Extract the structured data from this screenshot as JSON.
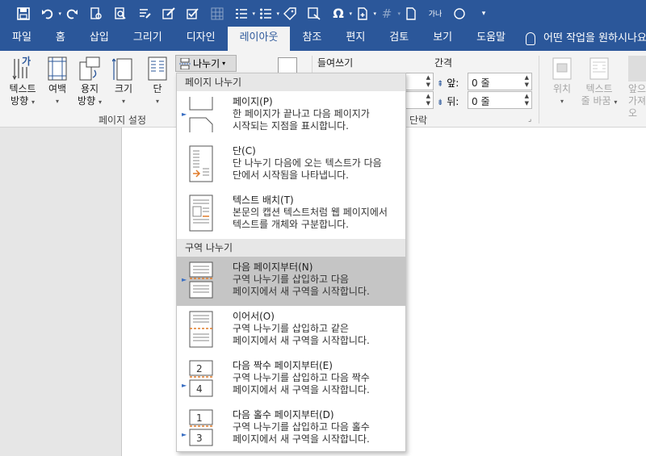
{
  "qat": {
    "buttons": [
      "save-icon",
      "undo-icon",
      "redo-icon",
      "print-preview-icon",
      "zoom-doc-icon",
      "format-painter-icon",
      "edit-icon",
      "edit-check-icon",
      "table-icon",
      "numbering-icon",
      "bullets-icon",
      "tag-icon",
      "insert-pic-icon",
      "omega-icon",
      "new-doc-icon",
      "hash-icon",
      "page-icon",
      "text-icon",
      "circle-icon",
      "more-icon"
    ],
    "text_small": "가나"
  },
  "tabs": [
    "파일",
    "홈",
    "삽입",
    "그리기",
    "디자인",
    "레이아웃",
    "참조",
    "편지",
    "검토",
    "보기",
    "도움말"
  ],
  "active_tab": "레이아웃",
  "tell_me": "어떤 작업을 원하시나요?",
  "ribbon": {
    "text_direction": [
      "텍스트",
      "방향"
    ],
    "margins": "여백",
    "orientation": [
      "용지",
      "방향"
    ],
    "size": "크기",
    "columns": "단",
    "group_page_setup": "페이지 설정",
    "breaks": "나누기",
    "indent_label": "들여쓰기",
    "spacing_label": "간격",
    "spacing_before_label": "앞:",
    "spacing_before": "0 줄",
    "spacing_after_label": "뒤:",
    "spacing_after": "0 줄",
    "group_paragraph": "단락",
    "position": "위치",
    "wrap_text": [
      "텍스트",
      "줄 바꿈"
    ],
    "bring_forward": [
      "앞으",
      "가져오"
    ]
  },
  "breaks_menu": {
    "section_page_breaks": "페이지 나누기",
    "section_section_breaks": "구역 나누기",
    "items": [
      {
        "title": "페이지(P)",
        "desc": [
          "한 페이지가 끝나고 다음 페이지가",
          "시작되는 지점을 표시합니다."
        ]
      },
      {
        "title": "단(C)",
        "desc": [
          "단 나누기 다음에 오는 텍스트가 다음",
          "단에서 시작됨을 나타냅니다."
        ]
      },
      {
        "title": "텍스트 배치(T)",
        "desc": [
          "본문의 캡션 텍스트처럼 웹 페이지에서",
          "텍스트를 개체와 구분합니다."
        ]
      },
      {
        "title": "다음 페이지부터(N)",
        "desc": [
          "구역 나누기를 삽입하고 다음",
          "페이지에서 새 구역을 시작합니다."
        ]
      },
      {
        "title": "이어서(O)",
        "desc": [
          "구역 나누기를 삽입하고 같은",
          "페이지에서 새 구역을 시작합니다."
        ]
      },
      {
        "title": "다음 짝수 페이지부터(E)",
        "desc": [
          "구역 나누기를 삽입하고 다음 짝수",
          "페이지에서 새 구역을 시작합니다."
        ]
      },
      {
        "title": "다음 홀수 페이지부터(D)",
        "desc": [
          "구역 나누기를 삽입하고 다음 홀수",
          "페이지에서 새 구역을 시작합니다."
        ]
      }
    ],
    "selected_index": 3,
    "icon_numbers": [
      "2",
      "4",
      "1",
      "3"
    ]
  },
  "colors": {
    "title_bar": "#2b579a",
    "ribbon_bg": "#f3f3f3",
    "selected_item": "#c5c5c5",
    "accent_orange": "#e07b2a"
  }
}
